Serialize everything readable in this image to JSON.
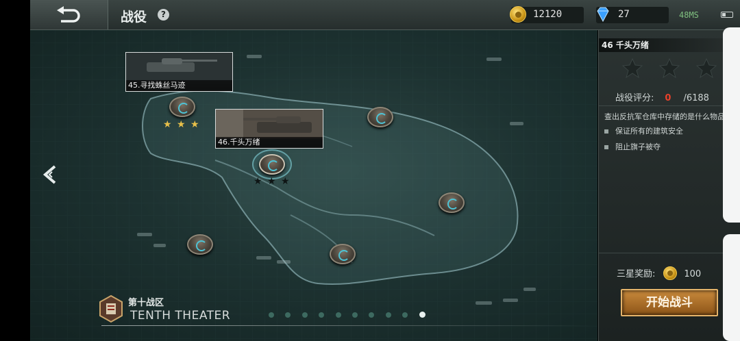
{
  "topbar": {
    "title": "战役",
    "help": "?",
    "gold": "12120",
    "diamonds": "27",
    "latency": "48MS"
  },
  "panel": {
    "mission_title": "46 千头万绪",
    "stars_earned": 0,
    "stars_total": 3,
    "rating_label": "战役评分:",
    "rating_score": "0",
    "rating_max": "/6188",
    "description": "查出反抗军仓库中存储的是什么物品",
    "objectives": [
      "保证所有的建筑安全",
      "阻止旗子被夺"
    ],
    "reward_label": "三星奖励:",
    "reward_amount": "100",
    "start_button": "开始战斗"
  },
  "map": {
    "levels": [
      {
        "label": "45.寻找蛛丝马迹",
        "stars": 3
      },
      {
        "label": "46.千头万绪",
        "stars": 0
      }
    ]
  },
  "theater": {
    "name_cn": "第十战区",
    "name_en": "TENTH THEATER",
    "page_count": 10,
    "active_page": 10
  },
  "colors": {
    "accent_gold": "#c99416",
    "star_gold": "#e8c04a",
    "score_red": "#e8402a",
    "node_cyan": "#4dc4d6"
  }
}
